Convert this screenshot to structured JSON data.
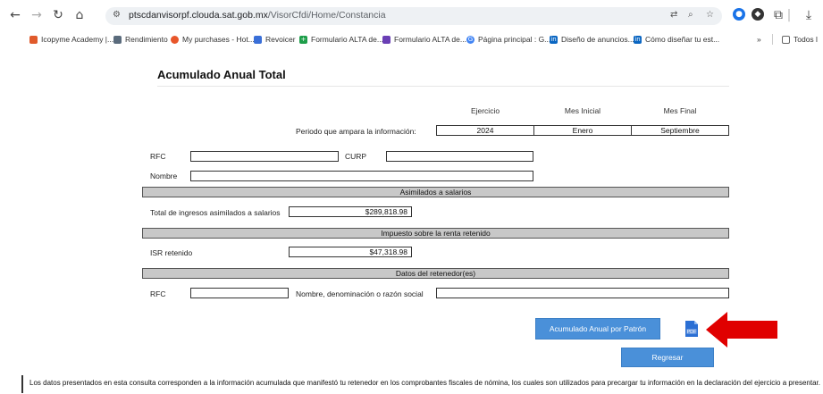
{
  "browser": {
    "url_host": "ptscdanvisorpf.clouda.sat.gob.mx",
    "url_path": "/VisorCfdi/Home/Constancia",
    "bookmarks": [
      {
        "label": "Icopyme Academy |...",
        "icon": "academy-icon",
        "color": "#e05a2b"
      },
      {
        "label": "Rendimiento",
        "icon": "gear-icon",
        "color": "#5a6b7c"
      },
      {
        "label": "My purchases - Hot...",
        "icon": "flame-icon",
        "color": "#e8562a"
      },
      {
        "label": "Revoicer",
        "icon": "menu-icon",
        "color": "#3a6fd8"
      },
      {
        "label": "Formulario ALTA de...",
        "icon": "plus-icon",
        "color": "#1e9e4a"
      },
      {
        "label": "Formulario ALTA de...",
        "icon": "form-icon",
        "color": "#6a3fb5"
      },
      {
        "label": "Página principal : G...",
        "icon": "google-icon",
        "color": "#4285f4"
      },
      {
        "label": "Diseño de anuncios...",
        "icon": "linkedin-icon",
        "color": "#0a66c2"
      },
      {
        "label": "Cómo diseñar tu est...",
        "icon": "linkedin-icon",
        "color": "#0a66c2"
      },
      {
        "label": "Todos l",
        "icon": "folder-icon",
        "color": "#666666"
      }
    ]
  },
  "page": {
    "title": "Acumulado Anual Total",
    "period_label": "Periodo que ampara la información:",
    "columns": {
      "ejercicio": "Ejercicio",
      "mes_inicial": "Mes Inicial",
      "mes_final": "Mes Final"
    },
    "period_values": {
      "ejercicio": "2024",
      "mes_inicial": "Enero",
      "mes_final": "Septiembre"
    },
    "rfc_label": "RFC",
    "curp_label": "CURP",
    "nombre_label": "Nombre",
    "section_asimilados": "Asimilados a salarios",
    "total_ingresos_label": "Total de ingresos asimilados a salarios",
    "total_ingresos_value": "$289,818.98",
    "section_impuesto": "Impuesto sobre la renta retenido",
    "isr_label": "ISR retenido",
    "isr_value": "$47,318.98",
    "section_retenedor": "Datos del retenedor(es)",
    "retenedor_rfc_label": "RFC",
    "retenedor_nombre_label": "Nombre, denominación o razón social",
    "btn_patron": "Acumulado Anual por Patrón",
    "btn_regresar": "Regresar",
    "pdf_label": "PDF",
    "footer": "Los datos presentados en esta consulta corresponden a la información acumulada que manifestó tu retenedor en los comprobantes fiscales de nómina, los cuales son utilizados para precargar tu información en la declaración del ejercicio a presentar.",
    "accent_color": "#4a90d9",
    "arrow_color": "#e00000"
  }
}
